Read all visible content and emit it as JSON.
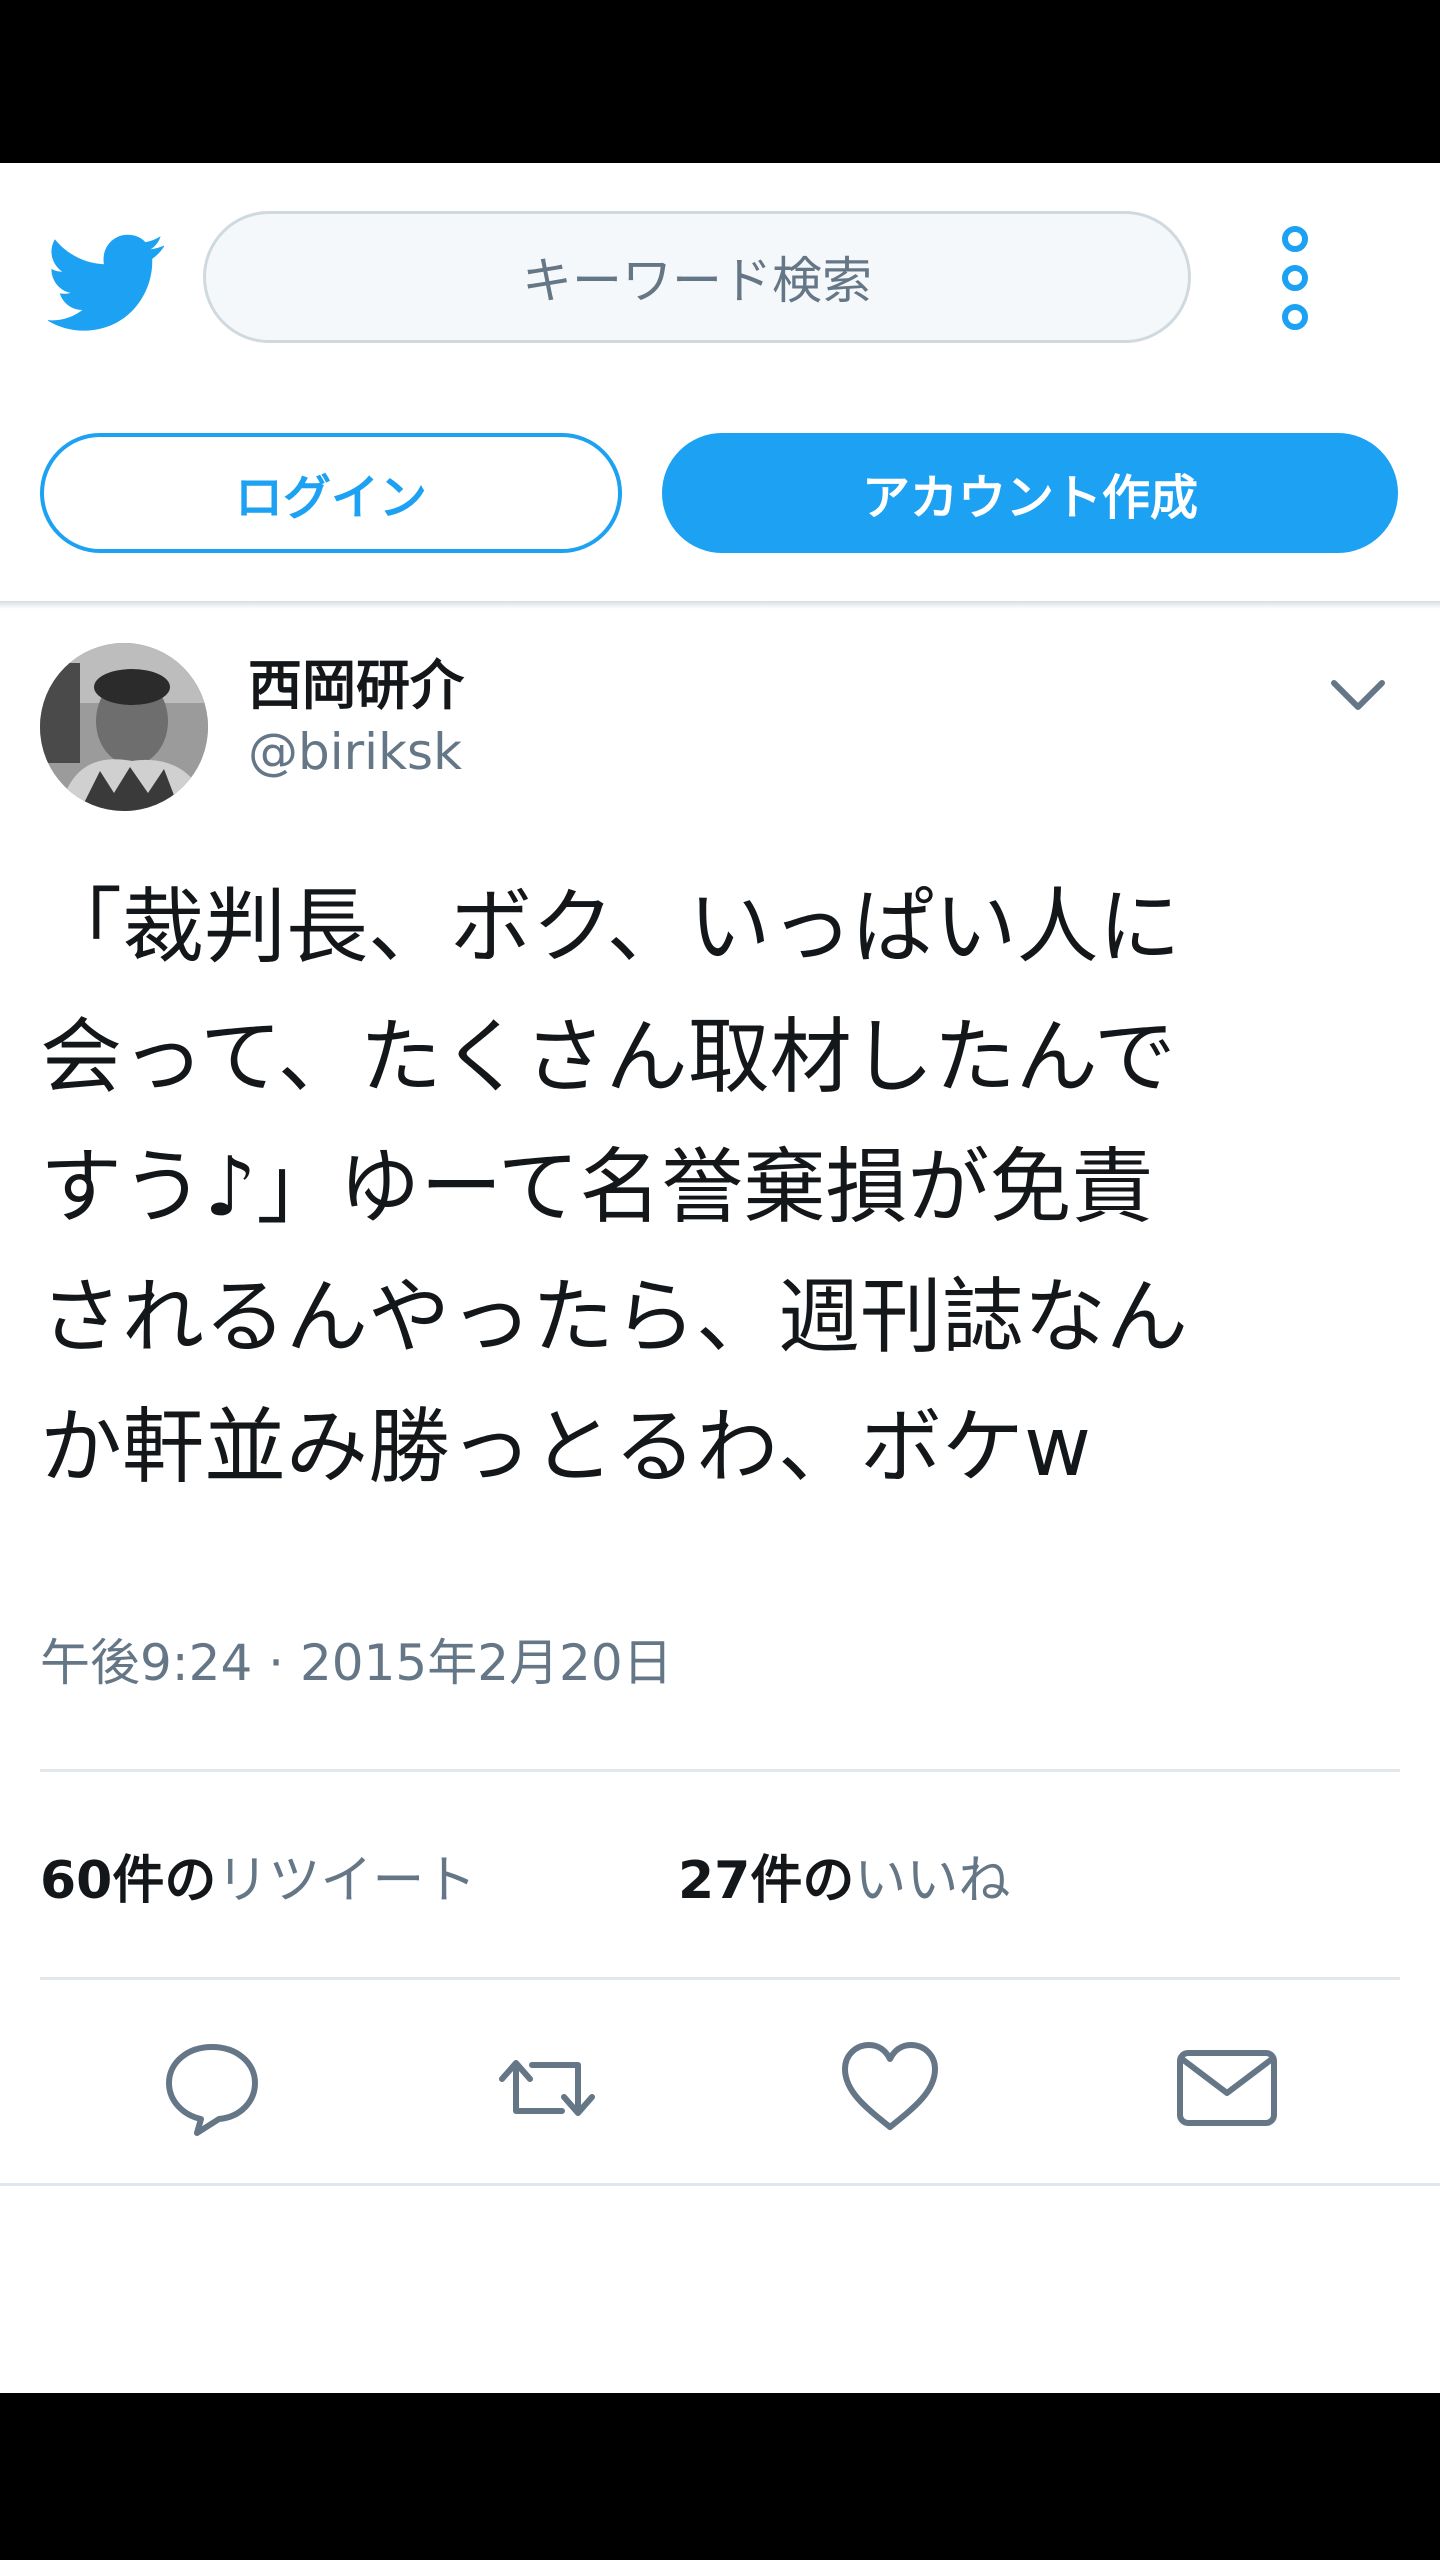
{
  "header": {
    "search_placeholder": "キーワード検索",
    "login_label": "ログイン",
    "signup_label": "アカウント作成"
  },
  "tweet": {
    "name": "西岡研介",
    "handle": "@biriksk",
    "text": "「裁判長、ボク、いっぱい人に\n会って、たくさん取材したんで\nすう♪」ゆーて名誉棄損が免責\nされるんやったら、週刊誌なん\nか軒並み勝っとるわ、ボケw",
    "timestamp": "午後9:24 · 2015年2月20日",
    "retweets": {
      "count": "60件の",
      "label": "リツイート"
    },
    "likes": {
      "count": "27件の",
      "label": "いいね"
    }
  },
  "icons": {
    "logo": "twitter-bird-icon",
    "menu": "more-vertical-icon",
    "chevron": "chevron-down-icon",
    "reply": "reply-icon",
    "retweet": "retweet-icon",
    "like": "heart-icon",
    "share": "mail-icon"
  },
  "colors": {
    "accent": "#1da1f2",
    "text": "#14171a",
    "muted": "#657786",
    "border": "#e1e8ed"
  }
}
